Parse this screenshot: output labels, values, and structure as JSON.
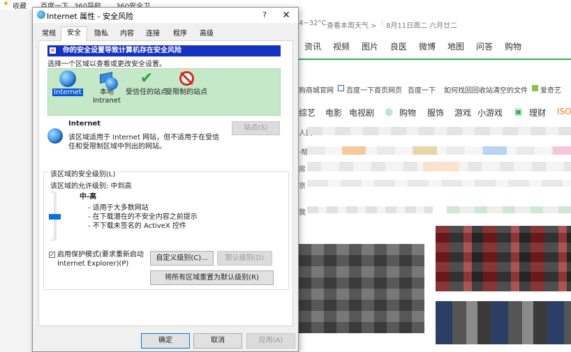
{
  "browser": {
    "favorites": [
      "收藏",
      "百度一下",
      "360导航",
      "360安全卫"
    ],
    "temperature": "4~32°C",
    "weather_link": "查看本周天气 >",
    "date": "8月11日周二",
    "lunar_date": "六月廿二",
    "nav_items": [
      "资讯",
      "视频",
      "图片",
      "良医",
      "微博",
      "地图",
      "问答",
      "购物"
    ],
    "bookmarks": [
      "购商城官网",
      "百度一下首页网页",
      "百度一下",
      "如何找回回收站清空的文件",
      "爱奇艺"
    ],
    "categories": [
      "综艺",
      "电影",
      "电视剧",
      "购物",
      "服饰",
      "游戏",
      "小游戏",
      "理财",
      "ISO"
    ],
    "side_labels": [
      "人民",
      "·帮",
      "房",
      "京",
      "我"
    ]
  },
  "dialog": {
    "title": "Internet 属性 - 安全风险",
    "help_label": "?",
    "close_label": "✕",
    "tabs": [
      "常规",
      "安全",
      "隐私",
      "内容",
      "连接",
      "程序",
      "高级"
    ],
    "active_tab": "安全",
    "warning_banner": "你的安全设置导致计算机存在安全风险",
    "instruction": "选择一个区域以查看或更改安全设置。",
    "zones": [
      {
        "name": "Internet",
        "icon": "globe-icon",
        "selected": true
      },
      {
        "name": "本地 Intranet",
        "icon": "intranet-icon",
        "selected": false
      },
      {
        "name": "受信任的站点",
        "icon": "checkmark-icon",
        "selected": false
      },
      {
        "name": "受限制的站点",
        "icon": "prohibited-icon",
        "selected": false
      }
    ],
    "zone_title": "Internet",
    "zone_description": "该区域适用于 Internet 网站，但不适用于在受信任和受限制区域中列出的网站。",
    "sites_button": "站点(S)",
    "group_label": "该区域的安全级别(L)",
    "allowed_levels": "该区域的允许级别: 中到高",
    "level_name": "中-高",
    "level_bullets": [
      "- 适用于大多数网站",
      "- 在下载潜在的不安全内容之前提示",
      "- 不下载未签名的 ActiveX 控件"
    ],
    "slider_level": "中-高",
    "protected_mode_label": "启用保护模式(要求重新启动 Internet Explorer)(P)",
    "protected_mode_checked": true,
    "custom_level_button": "自定义级别(C)...",
    "default_level_button": "默认级别(D)",
    "reset_all_button": "将所有区域重置为默认级别(R)",
    "ok_button": "确定",
    "cancel_button": "取消",
    "apply_button": "应用(A)"
  },
  "colors": {
    "banner_blue": "#1531c2",
    "zone_green": "#c4e8c8",
    "selection_blue": "#0a57d6",
    "accent_green": "#2bb24c"
  }
}
